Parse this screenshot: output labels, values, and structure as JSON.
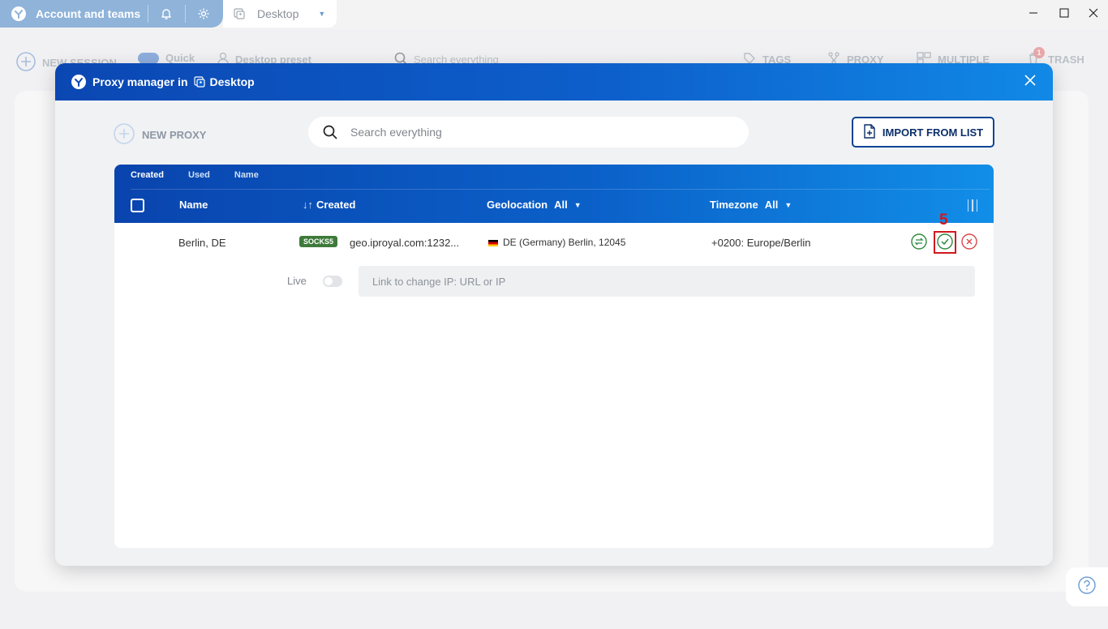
{
  "titlebar": {
    "account_label": "Account and teams",
    "tab_title": "Desktop",
    "icons": [
      "app-logo-icon",
      "bell-icon",
      "gear-icon",
      "desktop-icon",
      "chevron-down-icon",
      "minimize-icon",
      "maximize-icon",
      "close-icon"
    ]
  },
  "background_toolbar": {
    "new_session": "NEW SESSION",
    "quick": "Quick",
    "preset": "Desktop preset",
    "search_placeholder": "Search everything",
    "tags": "TAGS",
    "proxy": "PROXY",
    "multiple": "MULTIPLE",
    "trash": "TRASH",
    "trash_count": "1"
  },
  "modal": {
    "title": "Proxy manager in",
    "desktop_name": "Desktop",
    "new_proxy": "NEW PROXY",
    "search_placeholder": "Search everything",
    "import_label": "IMPORT FROM LIST"
  },
  "table": {
    "sort_tabs": [
      "Created",
      "Used",
      "Name"
    ],
    "active_sort": "Created",
    "columns": {
      "name": "Name",
      "created": "Created",
      "geolocation": "Geolocation",
      "geolocation_filter": "All",
      "timezone": "Timezone",
      "timezone_filter": "All"
    },
    "rows": [
      {
        "name": "Berlin, DE",
        "protocol": "SOCKS5",
        "host": "geo.iproyal.com:1232...",
        "geolocation": "DE (Germany) Berlin, 12045",
        "timezone": "+0200: Europe/Berlin",
        "live_label": "Live",
        "live_enabled": false,
        "ip_link_placeholder": "Link to change IP: URL or IP"
      }
    ]
  },
  "annotation": {
    "step_number": "5"
  },
  "colors": {
    "brand_blue": "#0b47b3",
    "header_gradient_end": "#1189e6",
    "socks_badge": "#3e7a3a",
    "check_green": "#2e8b3e",
    "delete_red": "#d9474a",
    "highlight_red": "#d0191c"
  }
}
